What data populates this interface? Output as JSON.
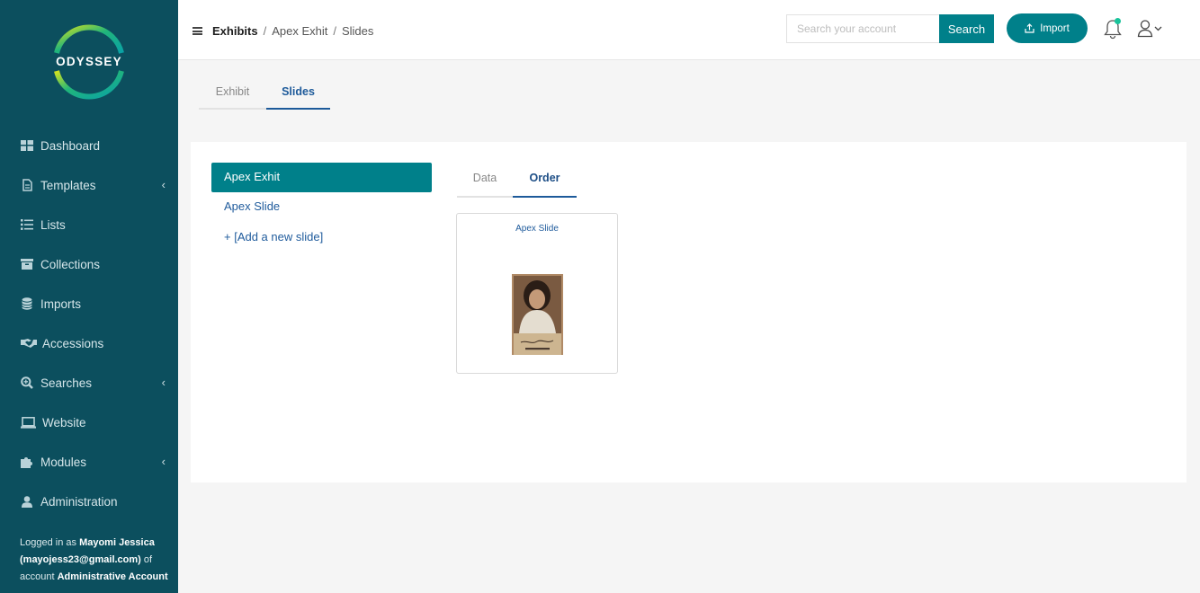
{
  "sidebar": {
    "brand": "ODYSSEY",
    "items": [
      {
        "label": "Dashboard",
        "icon": "dashboard-icon",
        "has_submenu": false
      },
      {
        "label": "Templates",
        "icon": "file-icon",
        "has_submenu": true
      },
      {
        "label": "Lists",
        "icon": "list-icon",
        "has_submenu": false
      },
      {
        "label": "Collections",
        "icon": "archive-icon",
        "has_submenu": false
      },
      {
        "label": "Imports",
        "icon": "database-icon",
        "has_submenu": false
      },
      {
        "label": "Accessions",
        "icon": "handshake-icon",
        "has_submenu": false
      },
      {
        "label": "Searches",
        "icon": "search-zoom-icon",
        "has_submenu": true
      },
      {
        "label": "Website",
        "icon": "laptop-icon",
        "has_submenu": false
      },
      {
        "label": "Modules",
        "icon": "puzzle-icon",
        "has_submenu": true
      },
      {
        "label": "Administration",
        "icon": "user-icon",
        "has_submenu": false
      }
    ],
    "footer": {
      "prefix": "Logged in as",
      "user_name": "Mayomi Jessica",
      "user_email": "(mayojess23@gmail.com)",
      "of_account": "of account",
      "account_name": "Administrative Account"
    }
  },
  "header": {
    "breadcrumb": [
      "Exhibits",
      "Apex Exhit",
      "Slides"
    ],
    "search_placeholder": "Search your account",
    "search_button": "Search",
    "import_button": "Import"
  },
  "tabs": {
    "exhibit": "Exhibit",
    "slides": "Slides",
    "active": "Slides"
  },
  "slides": {
    "active_item": "Apex Exhit",
    "items": [
      "Apex Slide"
    ],
    "add_link": "+ [Add a new slide]"
  },
  "subtabs": {
    "data": "Data",
    "order": "Order",
    "active": "Order"
  },
  "cards": [
    {
      "title": "Apex Slide"
    }
  ],
  "colors": {
    "sidebar_bg": "#0c4f5e",
    "accent": "#00808a",
    "link": "#1f5b9c",
    "notification_dot": "#18c39a"
  }
}
